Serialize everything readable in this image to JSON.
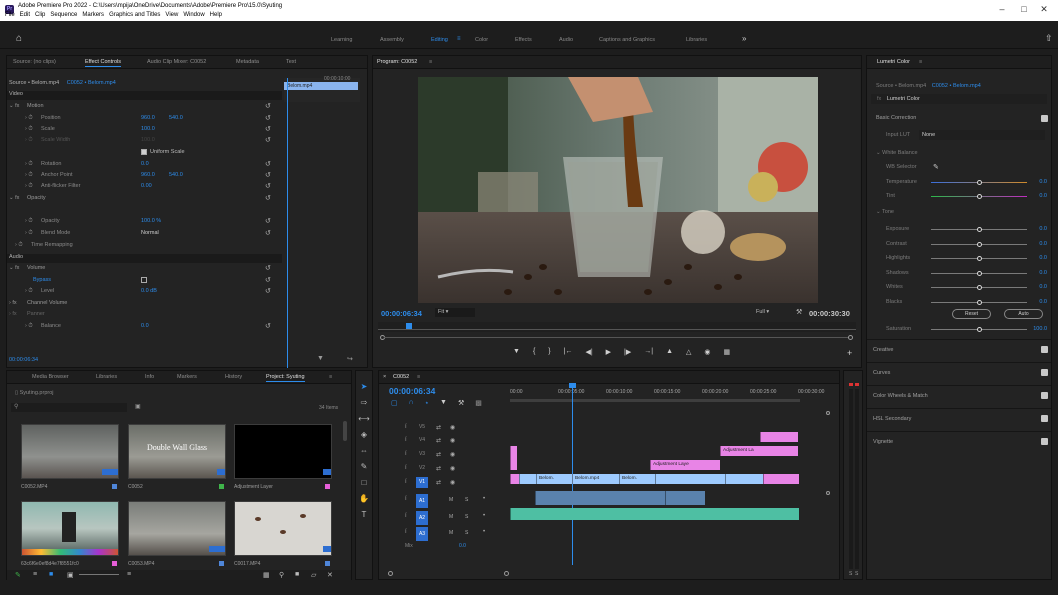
{
  "window": {
    "title": "Adobe Premiere Pro 2022 - C:\\Users\\mpija\\OneDrive\\Documents\\Adobe\\Premiere Pro\\15.0\\Syuting",
    "menu": [
      "File",
      "Edit",
      "Clip",
      "Sequence",
      "Markers",
      "Graphics and Titles",
      "View",
      "Window",
      "Help"
    ]
  },
  "workspaces": [
    "Learning",
    "Assembly",
    "Editing",
    "Color",
    "Effects",
    "Audio",
    "Captions and Graphics",
    "Libraries"
  ],
  "workspace_active": "Editing",
  "source_panel": {
    "tabs": [
      "Source: (no clips)",
      "Effect Controls",
      "Audio Clip Mixer: C0052",
      "Metadata",
      "Text"
    ],
    "active_tab": "Effect Controls",
    "source_label": "Source • Belom.mp4",
    "sequence_label": "C0052 • Belom.mp4",
    "mini_clip": "Belom.mp4",
    "mini_time": "00:00:10:00",
    "sections": {
      "video": "Video",
      "audio": "Audio"
    },
    "rows": [
      {
        "label": "Motion",
        "fx": true
      },
      {
        "label": "Position",
        "value": "960.0",
        "value2": "540.0"
      },
      {
        "label": "Scale",
        "value": "100.0"
      },
      {
        "label": "Scale Width",
        "value": "100.0"
      },
      {
        "label": "Uniform Scale"
      },
      {
        "label": "Rotation",
        "value": "0.0"
      },
      {
        "label": "Anchor Point",
        "value": "960.0",
        "value2": "540.0"
      },
      {
        "label": "Anti-flicker Filter",
        "value": "0.00"
      },
      {
        "label": "Opacity",
        "fx": true
      },
      {
        "label": "Opacity",
        "value": "100.0 %"
      },
      {
        "label": "Blend Mode",
        "value": "Normal"
      },
      {
        "label": "Time Remapping"
      },
      {
        "label": "Volume",
        "fx": true
      },
      {
        "label": "Bypass"
      },
      {
        "label": "Level",
        "value": "0.0 dB"
      },
      {
        "label": "Channel Volume"
      },
      {
        "label": "Panner"
      },
      {
        "label": "Balance",
        "value": "0.0"
      }
    ],
    "timecode": "00:00:06:34"
  },
  "program_panel": {
    "title": "Program: C0052",
    "timecode": "00:00:06:34",
    "fit": "Fit",
    "quality": "Full",
    "duration": "00:00:30:30"
  },
  "project_panel": {
    "tabs": [
      "Media Browser",
      "Libraries",
      "Info",
      "Markers",
      "History",
      "Project: Syuting"
    ],
    "active_tab": "Project: Syuting",
    "project_file": "Syuting.prproj",
    "item_count": "34 Items",
    "items": [
      {
        "name": "C0052.MP4",
        "color": "#4f86d9"
      },
      {
        "name": "C0052",
        "color": "#3fb44a",
        "overlay_text": "Double Wall Glass"
      },
      {
        "name": "Adjustment Layer",
        "color": "#e65ed8"
      },
      {
        "name": "63c6f6e0ef8d4e7f8551fc0",
        "color": "#e65ed8"
      },
      {
        "name": "C0053.MP4",
        "color": "#4f86d9"
      },
      {
        "name": "C0017.MP4",
        "color": "#4f86d9"
      }
    ]
  },
  "timeline": {
    "sequence": "C0052",
    "timecode": "00:00:06:34",
    "ruler": [
      "00:00",
      "00:00:05:00",
      "00:00:10:00",
      "00:00:15:00",
      "00:00:20:00",
      "00:00:25:00",
      "00:00:30:00"
    ],
    "tracks": [
      {
        "name": "V5"
      },
      {
        "name": "V4"
      },
      {
        "name": "V3"
      },
      {
        "name": "V2"
      },
      {
        "name": "V1",
        "active": true
      },
      {
        "name": "A1",
        "audio": true,
        "active": true
      },
      {
        "name": "A2",
        "audio": true,
        "active": true
      },
      {
        "name": "A3",
        "audio": true,
        "active": true
      }
    ],
    "track_letters": [
      "M",
      "S"
    ],
    "mix": {
      "label": "Mix",
      "value": "0.0"
    },
    "clips": {
      "v1_a": "Belom.",
      "v1_b": "Belom.mp4",
      "v1_c": "Belom.",
      "adjust_v2": "Adjustment Laye",
      "adjust_v3": "Adjustment La"
    },
    "meter": [
      "S",
      "S"
    ]
  },
  "lumetri": {
    "title": "Lumetri Color",
    "source": "Source • Belom.mp4",
    "sequence": "C0052 • Belom.mp4",
    "fx_name": "Lumetri Color",
    "basic": "Basic Correction",
    "input_lut_label": "Input LUT",
    "input_lut": "None",
    "white_balance": "White Balance",
    "wb_selector": "WB Selector",
    "wb": [
      {
        "label": "Temperature",
        "value": "0.0"
      },
      {
        "label": "Tint",
        "value": "0.0"
      }
    ],
    "tone": "Tone",
    "tone_rows": [
      {
        "label": "Exposure",
        "value": "0.0"
      },
      {
        "label": "Contrast",
        "value": "0.0"
      },
      {
        "label": "Highlights",
        "value": "0.0"
      },
      {
        "label": "Shadows",
        "value": "0.0"
      },
      {
        "label": "Whites",
        "value": "0.0"
      },
      {
        "label": "Blacks",
        "value": "0.0"
      }
    ],
    "reset": "Reset",
    "auto": "Auto",
    "saturation": {
      "label": "Saturation",
      "value": "100.0"
    },
    "sections": [
      "Creative",
      "Curves",
      "Color Wheels & Match",
      "HSL Secondary",
      "Vignette"
    ]
  },
  "colors": {
    "accent": "#2d8ceb",
    "video_clip": "#9ecbff",
    "adjust_clip": "#e884e6",
    "audio_clip": "#4ebfa3"
  }
}
